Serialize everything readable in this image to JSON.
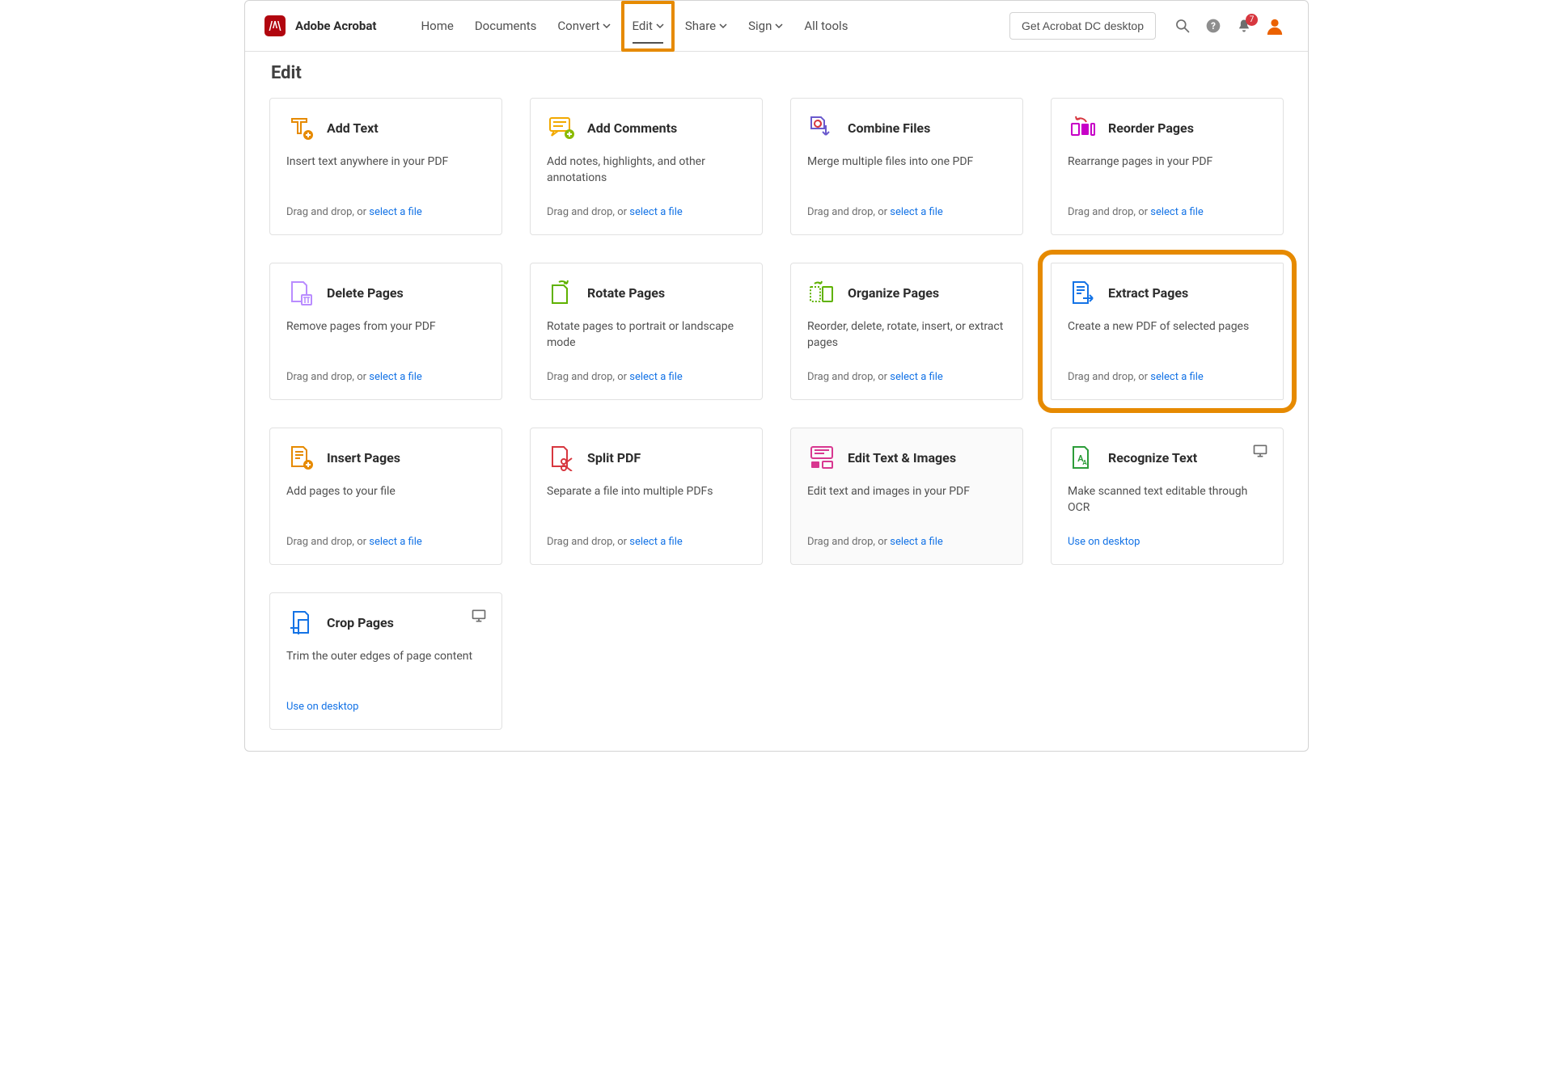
{
  "brand": "Adobe Acrobat",
  "nav": {
    "home": "Home",
    "documents": "Documents",
    "convert": "Convert",
    "edit": "Edit",
    "share": "Share",
    "sign": "Sign",
    "all_tools": "All tools"
  },
  "cta": "Get Acrobat DC desktop",
  "notifications_count": "7",
  "page_title": "Edit",
  "drop_prefix": "Drag and drop, or ",
  "select_file": "select a file",
  "desktop_link": "Use on desktop",
  "cards": {
    "add_text": {
      "title": "Add Text",
      "desc": "Insert text anywhere in your PDF"
    },
    "add_comments": {
      "title": "Add Comments",
      "desc": "Add notes, highlights, and other annotations"
    },
    "combine": {
      "title": "Combine Files",
      "desc": "Merge multiple files into one PDF"
    },
    "reorder": {
      "title": "Reorder Pages",
      "desc": "Rearrange pages in your PDF"
    },
    "delete": {
      "title": "Delete Pages",
      "desc": "Remove pages from your PDF"
    },
    "rotate": {
      "title": "Rotate Pages",
      "desc": "Rotate pages to portrait or landscape mode"
    },
    "organize": {
      "title": "Organize Pages",
      "desc": "Reorder, delete, rotate, insert, or extract pages"
    },
    "extract": {
      "title": "Extract Pages",
      "desc": "Create a new PDF of selected pages"
    },
    "insert": {
      "title": "Insert Pages",
      "desc": "Add pages to your file"
    },
    "split": {
      "title": "Split PDF",
      "desc": "Separate a file into multiple PDFs"
    },
    "edit_ti": {
      "title": "Edit Text & Images",
      "desc": "Edit text and images in your PDF"
    },
    "recognize": {
      "title": "Recognize Text",
      "desc": "Make scanned text editable through OCR"
    },
    "crop": {
      "title": "Crop Pages",
      "desc": "Trim the outer edges of page content"
    }
  }
}
